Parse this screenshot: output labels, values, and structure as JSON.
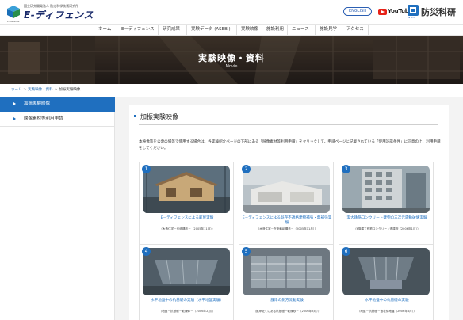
{
  "header": {
    "org_name": "国立研究開発法人 防災科学技術研究所",
    "logo_text": "E-ディフェンス",
    "logo_sub": "E-Defense",
    "english_label": "ENGLISH",
    "youtube_label": "YouTube",
    "nied_label": "防災科研",
    "nied_sub": "NIED"
  },
  "nav": {
    "items": [
      "ホーム",
      "E－ディフェンス",
      "研究成果",
      "実験データ (ASEBI)",
      "実験映像",
      "施設利用",
      "ニュース",
      "施設見学",
      "アクセス"
    ]
  },
  "hero": {
    "title": "実験映像・資料",
    "subtitle": "Movie"
  },
  "breadcrumb": {
    "items": [
      "ホーム",
      "実験映像・資料",
      "加振実験映像"
    ]
  },
  "sidebar": {
    "items": [
      {
        "label": "加振実験映像",
        "active": true
      },
      {
        "label": "映像素材等利用申請",
        "active": false
      }
    ]
  },
  "main": {
    "section_title": "加振実験映像",
    "intro": "本映像等を公衆の場等で使用する場合は、各実験紹介ページの下部にある「映像素材等利用申請」をクリックして、申請ページに記載されている「使用許諾条件」に同意の上、利用申請をしてください。",
    "cards": [
      {
        "num": "1",
        "caption": "E－ディフェンスによる町屋実験",
        "sub": "（木造住宅－伝統構法－（2005年11月））"
      },
      {
        "num": "2",
        "caption": "E－ディフェンスによる既存不適格建物補強・無補強実験",
        "sub": "（木造住宅－在来軸組構法－（2005年11月））"
      },
      {
        "num": "3",
        "caption": "実大鉄筋コンクリート建物の三次元震動破壊実験",
        "sub": "（6階建て鉄筋コンクリート造建物（2006年1月））"
      },
      {
        "num": "4",
        "caption": "水平地盤中の杭基礎の実験（水平地盤実験）",
        "sub": "（地盤－抗基礎－乾燥砂－（2006年2月））"
      },
      {
        "num": "5",
        "caption": "護岸の側方流動実験",
        "sub": "（護岸近くにある杭基礎－乾燥砂－（2006年3月））"
      },
      {
        "num": "6",
        "caption": "水平地盤中の杭基礎の実験",
        "sub": "（地盤－抗基礎－液状化地盤（2006年8月））"
      }
    ]
  },
  "colors": {
    "accent": "#1f6fbf",
    "nav_text": "#333333",
    "hero_text": "#ffffff",
    "sidebar_active_bg": "#1f6fbf",
    "main_bg": "#f3f3f3",
    "youtube_red": "#e62117"
  }
}
